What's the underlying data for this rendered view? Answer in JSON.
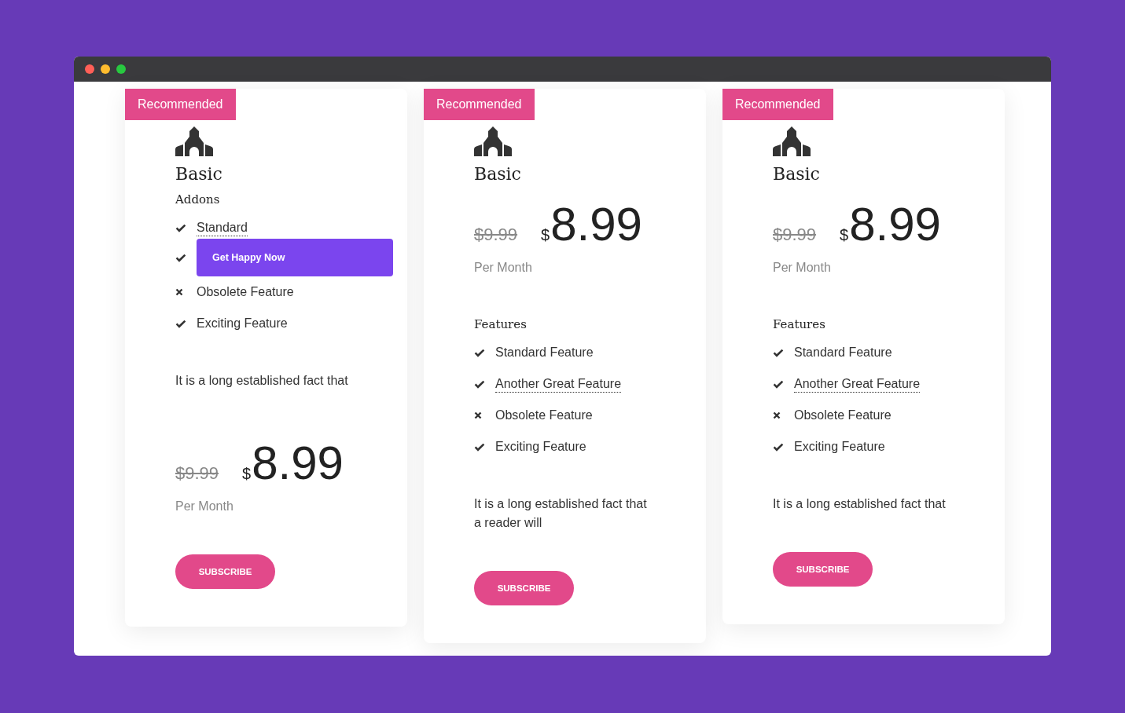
{
  "window_controls": [
    {
      "color": "#ff5f57"
    },
    {
      "color": "#febc2e"
    },
    {
      "color": "#28c840"
    }
  ],
  "plans": [
    {
      "ribbon": "Recommended",
      "title": "Basic",
      "sections": [
        {
          "kind": "heading",
          "text": "Addons"
        },
        {
          "kind": "features",
          "items": [
            {
              "kind": "text",
              "text": "Standard",
              "included": true,
              "underlined": true
            },
            {
              "kind": "button",
              "label": "Get Happy Now",
              "included": true
            },
            {
              "kind": "text",
              "text": "Obsolete Feature",
              "included": false,
              "underlined": false
            },
            {
              "kind": "text",
              "text": "Exciting Feature",
              "included": true,
              "underlined": false
            }
          ]
        },
        {
          "kind": "description",
          "text": "It is a long established fact that"
        },
        {
          "kind": "price",
          "old_price": "$9.99",
          "currency": "$",
          "amount": "8.99",
          "period": "Per Month"
        }
      ],
      "button": "SUBSCRIBE"
    },
    {
      "ribbon": "Recommended",
      "title": "Basic",
      "sections": [
        {
          "kind": "price",
          "old_price": "$9.99",
          "currency": "$",
          "amount": "8.99",
          "period": "Per Month"
        },
        {
          "kind": "heading",
          "text": "Features"
        },
        {
          "kind": "features",
          "items": [
            {
              "kind": "text",
              "text": "Standard Feature",
              "included": true,
              "underlined": false
            },
            {
              "kind": "text",
              "text": "Another Great Feature",
              "included": true,
              "underlined": true
            },
            {
              "kind": "text",
              "text": "Obsolete Feature",
              "included": false,
              "underlined": false
            },
            {
              "kind": "text",
              "text": "Exciting Feature",
              "included": true,
              "underlined": false
            }
          ]
        },
        {
          "kind": "description",
          "text": "It is a long established fact that\na reader will"
        }
      ],
      "button": "SUBSCRIBE"
    },
    {
      "ribbon": "Recommended",
      "title": "Basic",
      "sections": [
        {
          "kind": "price",
          "old_price": "$9.99",
          "currency": "$",
          "amount": "8.99",
          "period": "Per Month"
        },
        {
          "kind": "heading",
          "text": "Features"
        },
        {
          "kind": "features",
          "items": [
            {
              "kind": "text",
              "text": "Standard Feature",
              "included": true,
              "underlined": false
            },
            {
              "kind": "text",
              "text": "Another Great Feature",
              "included": true,
              "underlined": true
            },
            {
              "kind": "text",
              "text": "Obsolete Feature",
              "included": false,
              "underlined": false
            },
            {
              "kind": "text",
              "text": "Exciting Feature",
              "included": true,
              "underlined": false
            }
          ]
        },
        {
          "kind": "description",
          "text": "It is a long established fact that"
        }
      ],
      "button": "SUBSCRIBE"
    }
  ]
}
